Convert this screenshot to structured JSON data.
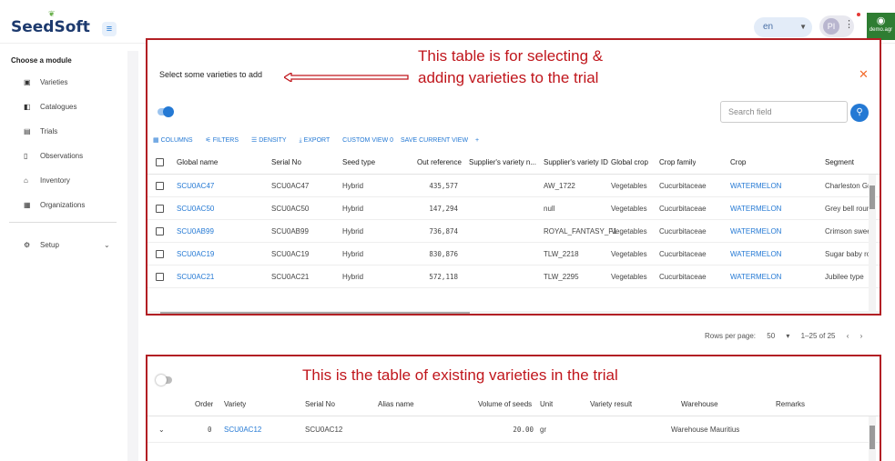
{
  "header": {
    "logo_text": "SeedSoft",
    "language": "en",
    "user_initials": "PI",
    "env_label": "demo.agr"
  },
  "sidebar": {
    "title": "Choose a module",
    "items": [
      {
        "label": "Varieties",
        "icon": "varieties-icon"
      },
      {
        "label": "Catalogues",
        "icon": "catalogues-icon"
      },
      {
        "label": "Trials",
        "icon": "trials-icon"
      },
      {
        "label": "Observations",
        "icon": "observations-icon"
      },
      {
        "label": "Inventory",
        "icon": "inventory-icon"
      },
      {
        "label": "Organizations",
        "icon": "organizations-icon"
      },
      {
        "label": "Setup",
        "icon": "setup-icon"
      }
    ]
  },
  "dialog": {
    "title": "Select some varieties to add",
    "annotation": "This table is for selecting &\nadding varieties to the trial",
    "search_placeholder": "Search field",
    "toolbar": {
      "columns": "COLUMNS",
      "filters": "FILTERS",
      "density": "DENSITY",
      "export": "EXPORT",
      "custom_view": "CUSTOM VIEW 0",
      "save_view": "SAVE CURRENT VIEW",
      "add": "+"
    },
    "columns": [
      "Global name",
      "Serial No",
      "Seed type",
      "Out reference",
      "Supplier's variety n...",
      "Supplier's variety ID",
      "Global crop",
      "Crop family",
      "Crop",
      "Segment"
    ],
    "rows": [
      [
        "SCU0AC47",
        "SCU0AC47",
        "Hybrid",
        "435,577",
        "",
        "AW_1722",
        "Vegetables",
        "Cucurbitaceae",
        "WATERMELON",
        "Charleston Gre"
      ],
      [
        "SCU0AC50",
        "SCU0AC50",
        "Hybrid",
        "147,294",
        "",
        "null",
        "Vegetables",
        "Cucurbitaceae",
        "WATERMELON",
        "Grey bell roun"
      ],
      [
        "SCU0AB99",
        "SCU0AB99",
        "Hybrid",
        "736,874",
        "",
        "ROYAL_FANTASY_F1",
        "Vegetables",
        "Cucurbitaceae",
        "WATERMELON",
        "Crimson swee"
      ],
      [
        "SCU0AC19",
        "SCU0AC19",
        "Hybrid",
        "830,876",
        "",
        "TLW_2218",
        "Vegetables",
        "Cucurbitaceae",
        "WATERMELON",
        "Sugar baby ro"
      ],
      [
        "SCU0AC21",
        "SCU0AC21",
        "Hybrid",
        "572,118",
        "",
        "TLW_2295",
        "Vegetables",
        "Cucurbitaceae",
        "WATERMELON",
        "Jubilee type"
      ]
    ],
    "pagination": {
      "rows_per_page_label": "Rows per page:",
      "rows_per_page": "50",
      "range": "1–25 of 25"
    }
  },
  "existing": {
    "annotation": "This is the table of existing varieties in the trial",
    "columns": [
      "Order",
      "Variety",
      "Serial No",
      "Alias name",
      "Volume of seeds",
      "Unit",
      "Variety result",
      "Warehouse",
      "Remarks"
    ],
    "rows": [
      [
        "0",
        "SCU0AC12",
        "SCU0AC12",
        "",
        "20.00",
        "gr",
        "",
        "Warehouse Mauritius",
        ""
      ]
    ]
  },
  "colors": {
    "accent": "#2479d4",
    "annotation_red": "#c0161c",
    "close_orange": "#f26b2c"
  }
}
